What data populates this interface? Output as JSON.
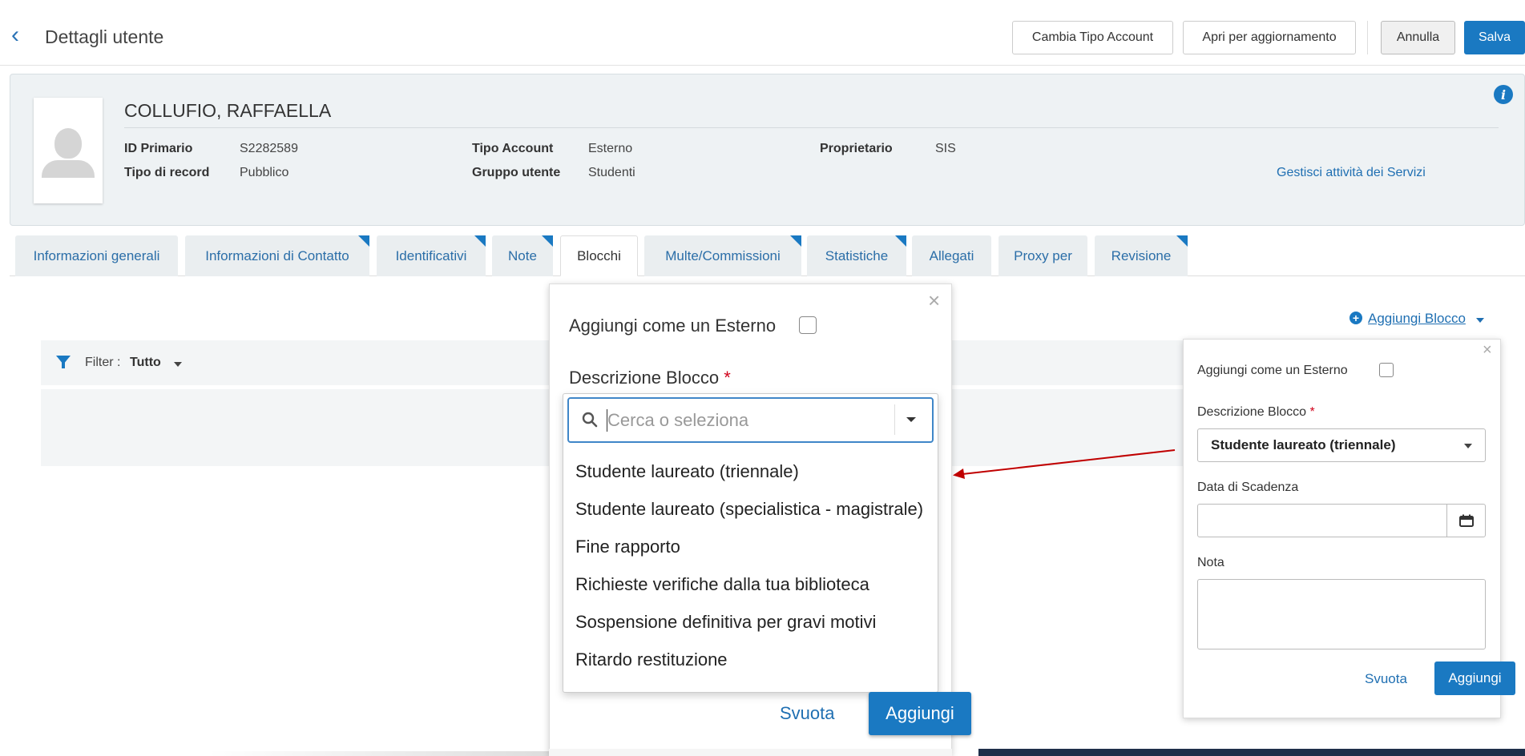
{
  "header": {
    "title": "Dettagli utente",
    "buttons": {
      "change_account_type": "Cambia Tipo Account",
      "open_for_update": "Apri per aggiornamento",
      "cancel": "Annulla",
      "save": "Salva"
    }
  },
  "user": {
    "name": "COLLUFIO, RAFFAELLA",
    "fields": [
      {
        "label": "ID Primario",
        "value": "S2282589"
      },
      {
        "label": "Tipo di record",
        "value": "Pubblico"
      },
      {
        "label": "Tipo Account",
        "value": "Esterno"
      },
      {
        "label": "Gruppo utente",
        "value": "Studenti"
      },
      {
        "label": "Proprietario",
        "value": "SIS"
      }
    ],
    "manage_link": "Gestisci attività dei Servizi"
  },
  "tabs": [
    {
      "label": "Informazioni generali",
      "active": false,
      "marked": false
    },
    {
      "label": "Informazioni di Contatto",
      "active": false,
      "marked": true
    },
    {
      "label": "Identificativi",
      "active": false,
      "marked": true
    },
    {
      "label": "Note",
      "active": false,
      "marked": true
    },
    {
      "label": "Blocchi",
      "active": true,
      "marked": false
    },
    {
      "label": "Multe/Commissioni",
      "active": false,
      "marked": true
    },
    {
      "label": "Statistiche",
      "active": false,
      "marked": true
    },
    {
      "label": "Allegati",
      "active": false,
      "marked": false
    },
    {
      "label": "Proxy per",
      "active": false,
      "marked": false
    },
    {
      "label": "Revisione",
      "active": false,
      "marked": true
    }
  ],
  "filter": {
    "label": "Filter :",
    "value": "Tutto"
  },
  "add_block_link": "Aggiungi Blocco",
  "big_popover": {
    "external_label": "Aggiungi come un Esterno",
    "description_label": "Descrizione Blocco",
    "required_mark": "*",
    "search_placeholder": "Cerca o seleziona",
    "options": [
      "Studente laureato (triennale)",
      "Studente laureato (specialistica - magistrale)",
      "Fine rapporto",
      "Richieste verifiche dalla tua biblioteca",
      "Sospensione definitiva per gravi motivi",
      "Ritardo restituzione"
    ],
    "clear_label": "Svuota",
    "add_label": "Aggiungi"
  },
  "small_popover": {
    "external_label": "Aggiungi come un Esterno",
    "description_label": "Descrizione Blocco",
    "required_mark": "*",
    "selected_value": "Studente laureato (triennale)",
    "expiry_label": "Data di Scadenza",
    "note_label": "Nota",
    "clear_label": "Svuota",
    "add_label": "Aggiungi"
  },
  "colors": {
    "accent": "#1a79c2",
    "link": "#1f6fb2",
    "required": "#d0021b",
    "annotation_arrow": "#c00000"
  }
}
